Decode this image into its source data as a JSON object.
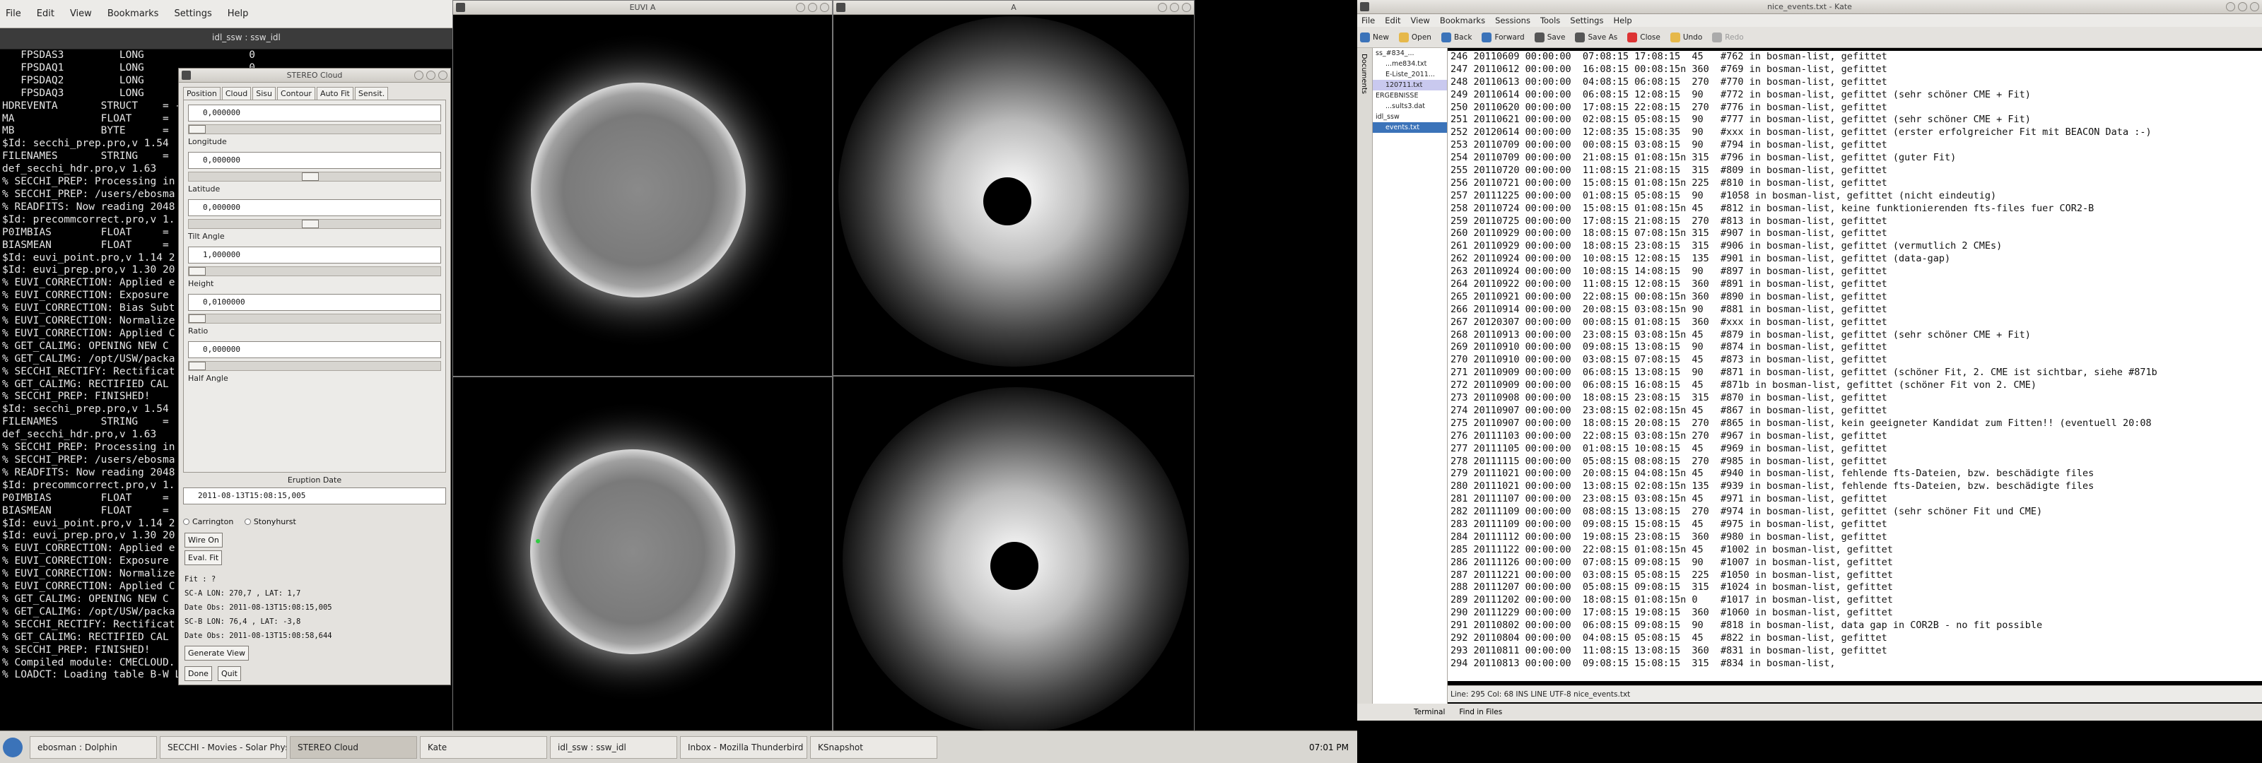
{
  "left_menu": [
    "File",
    "Edit",
    "View",
    "Bookmarks",
    "Settings",
    "Help"
  ],
  "terminal": {
    "title": "idl_ssw : ssw_idl",
    "lines": [
      "   FPSDAS3         LONG                 0",
      "   FPSDAQ1         LONG                 0",
      "   FPSDAQ2         LONG                 0",
      "   FPSDAQ3         LONG                 0",
      "HDREVENTA       STRUCT    = ->",
      "MA              FLOAT     =",
      "MB              BYTE      =",
      "",
      "$Id: secchi_prep.pro,v 1.54",
      "FILENAMES       STRING    =",
      "def_secchi_hdr.pro,v 1.63",
      "% SECCHI_PREP: Processing in",
      "% SECCHI_PREP: /users/ebosma",
      "% READFITS: Now reading 2048",
      "$Id: precommcorrect.pro,v 1.",
      "P0IMBIAS        FLOAT     =",
      "BIASMEAN        FLOAT     =",
      "$Id: euvi_point.pro,v 1.14 2",
      "$Id: euvi_prep.pro,v 1.30 20",
      "% EUVI_CORRECTION: Applied e",
      "% EUVI_CORRECTION: Exposure",
      "% EUVI_CORRECTION: Bias Subt",
      "% EUVI_CORRECTION: Normalize",
      "% EUVI_CORRECTION: Applied C",
      "% GET_CALIMG: OPENING NEW C",
      "% GET_CALIMG: /opt/USW/packa",
      "% SECCHI_RECTIFY: Rectificat",
      "% GET_CALIMG: RECTIFIED CAL",
      "% SECCHI_PREP: FINISHED!",
      "",
      "$Id: secchi_prep.pro,v 1.54",
      "FILENAMES       STRING    =",
      "def_secchi_hdr.pro,v 1.63",
      "% SECCHI_PREP: Processing in",
      "% SECCHI_PREP: /users/ebosma",
      "% READFITS: Now reading 2048",
      "$Id: precommcorrect.pro,v 1.",
      "P0IMBIAS        FLOAT     =",
      "BIASMEAN        FLOAT     =",
      "$Id: euvi_point.pro,v 1.14 2",
      "$Id: euvi_prep.pro,v 1.30 20",
      "% EUVI_CORRECTION: Applied e",
      "% EUVI_CORRECTION: Exposure",
      "% EUVI_CORRECTION: Normalize",
      "% EUVI_CORRECTION: Applied C",
      "% GET_CALIMG: OPENING NEW C",
      "% GET_CALIMG: /opt/USW/packa",
      "% SECCHI_RECTIFY: Rectificat",
      "% GET_CALIMG: RECTIFIED CAL",
      "% SECCHI_PREP: FINISHED!",
      "% Compiled module: CMECLOUD.",
      "% LOADCT: Loading table B-W LINEAR"
    ]
  },
  "cloud": {
    "title": "STEREO Cloud",
    "tabs": [
      "Position",
      "Cloud",
      "Sisu",
      "Contour",
      "Auto Fit",
      "Sensit."
    ],
    "fields": [
      {
        "label": "Longitude",
        "value": "0,000000"
      },
      {
        "label": "Latitude",
        "value": "0,000000"
      },
      {
        "label": "Tilt Angle",
        "value": "0,000000"
      },
      {
        "label": "Height",
        "value": "1,000000"
      },
      {
        "label": "Ratio",
        "value": "0,0100000"
      },
      {
        "label": "Half Angle",
        "value": "0,000000"
      }
    ],
    "eruption_label": "Eruption Date",
    "eruption_value": "2011-08-13T15:08:15,005",
    "radio_carrington": "Carrington",
    "radio_stonyhurst": "Stonyhurst",
    "wire_on": "Wire On",
    "eval_fit": "Eval. Fit",
    "fit_label": "Fit : ?",
    "sc_a": "SC-A LON:  270,7 , LAT:   1,7",
    "date_obs_a": "Date Obs: 2011-08-13T15:08:15,005",
    "sc_b": "SC-B LON:   76,4 , LAT:  -3,8",
    "date_obs_b": "Date Obs: 2011-08-13T15:08:58,644",
    "generate_view": "Generate View",
    "done": "Done",
    "quit": "Quit"
  },
  "image_windows": {
    "euvi_title": "EUVI A",
    "cor_title": "A"
  },
  "taskbar": [
    "ebosman : Dolphin",
    "SECCHI - Movies - Solar Physics",
    "STEREO Cloud",
    "Kate",
    "idl_ssw : ssw_idl",
    "Inbox - Mozilla Thunderbird",
    "KSnapshot"
  ],
  "clock": "07:01 PM",
  "kate": {
    "title": "nice_events.txt - Kate",
    "menu": [
      "File",
      "Edit",
      "View",
      "Bookmarks",
      "Sessions",
      "Tools",
      "Settings",
      "Help"
    ],
    "toolbar": [
      "New",
      "Open",
      "Back",
      "Forward",
      "Save",
      "Save As",
      "Close",
      "Undo",
      "Redo"
    ],
    "tree": [
      "ss_#834_...",
      "...me834.txt",
      "E-Liste_2011...",
      "120711.txt",
      "ERGEBNISSE",
      "...sults3.dat",
      "idl_ssw",
      "events.txt"
    ],
    "side_label": "Documents",
    "lines": [
      "246 20110609 00:00:00  07:08:15 17:08:15  45   #762 in bosman-list, gefittet",
      "247 20110612 00:00:00  16:08:15 00:08:15n 360  #769 in bosman-list, gefittet",
      "248 20110613 00:00:00  04:08:15 06:08:15  270  #770 in bosman-list, gefittet",
      "249 20110614 00:00:00  06:08:15 12:08:15  90   #772 in bosman-list, gefittet (sehr schöner CME + Fit)",
      "250 20110620 00:00:00  17:08:15 22:08:15  270  #776 in bosman-list, gefittet",
      "251 20110621 00:00:00  02:08:15 05:08:15  90   #777 in bosman-list, gefittet (sehr schöner CME + Fit)",
      "252 20120614 00:00:00  12:08:35 15:08:35  90   #xxx in bosman-list, gefittet (erster erfolgreicher Fit mit BEACON Data :-)",
      "253 20110709 00:00:00  00:08:15 03:08:15  90   #794 in bosman-list, gefittet",
      "254 20110709 00:00:00  21:08:15 01:08:15n 315  #796 in bosman-list, gefittet (guter Fit)",
      "255 20110720 00:00:00  11:08:15 21:08:15  315  #809 in bosman-list, gefittet",
      "256 20110721 00:00:00  15:08:15 01:08:15n 225  #810 in bosman-list, gefittet",
      "257 20111225 00:00:00  01:08:15 05:08:15  90   #1058 in bosman-list, gefittet (nicht eindeutig)",
      "258 20110724 00:00:00  15:08:15 01:08:15n 45   #812 in bosman-list, keine funktionierenden fts-files fuer COR2-B",
      "259 20110725 00:00:00  17:08:15 21:08:15  270  #813 in bosman-list, gefittet",
      "260 20110929 00:00:00  18:08:15 07:08:15n 315  #907 in bosman-list, gefittet",
      "261 20110929 00:00:00  18:08:15 23:08:15  315  #906 in bosman-list, gefittet (vermutlich 2 CMEs)",
      "262 20110924 00:00:00  10:08:15 12:08:15  135  #901 in bosman-list, gefittet (data-gap)",
      "263 20110924 00:00:00  10:08:15 14:08:15  90   #897 in bosman-list, gefittet",
      "264 20110922 00:00:00  11:08:15 12:08:15  360  #891 in bosman-list, gefittet",
      "265 20110921 00:00:00  22:08:15 00:08:15n 360  #890 in bosman-list, gefittet",
      "266 20110914 00:00:00  20:08:15 03:08:15n 90   #881 in bosman-list, gefittet",
      "267 20120307 00:00:00  00:08:15 01:08:15  360  #xxx in bosman-list, gefittet",
      "268 20110913 00:00:00  23:08:15 03:08:15n 45   #879 in bosman-list, gefittet (sehr schöner CME + Fit)",
      "269 20110910 00:00:00  09:08:15 13:08:15  90   #874 in bosman-list, gefittet",
      "270 20110910 00:00:00  03:08:15 07:08:15  45   #873 in bosman-list, gefittet",
      "271 20110909 00:00:00  06:08:15 13:08:15  90   #871 in bosman-list, gefittet (schöner Fit, 2. CME ist sichtbar, siehe #871b",
      "272 20110909 00:00:00  06:08:15 16:08:15  45   #871b in bosman-list, gefittet (schöner Fit von 2. CME)",
      "273 20110908 00:00:00  18:08:15 23:08:15  315  #870 in bosman-list, gefittet",
      "274 20110907 00:00:00  23:08:15 02:08:15n 45   #867 in bosman-list, gefittet",
      "275 20110907 00:00:00  18:08:15 20:08:15  270  #865 in bosman-list, kein geeigneter Kandidat zum Fitten!! (eventuell 20:08",
      "276 20111103 00:00:00  22:08:15 03:08:15n 270  #967 in bosman-list, gefittet",
      "277 20111105 00:00:00  01:08:15 10:08:15  45   #969 in bosman-list, gefittet",
      "278 20111115 00:00:00  05:08:15 08:08:15  270  #985 in bosman-list, gefittet",
      "279 20111021 00:00:00  20:08:15 04:08:15n 45   #940 in bosman-list, fehlende fts-Dateien, bzw. beschädigte files",
      "280 20111021 00:00:00  13:08:15 02:08:15n 135  #939 in bosman-list, fehlende fts-Dateien, bzw. beschädigte files",
      "281 20111107 00:00:00  23:08:15 03:08:15n 45   #971 in bosman-list, gefittet",
      "282 20111109 00:00:00  08:08:15 13:08:15  270  #974 in bosman-list, gefittet (sehr schöner Fit und CME)",
      "283 20111109 00:00:00  09:08:15 15:08:15  45   #975 in bosman-list, gefittet",
      "284 20111112 00:00:00  19:08:15 23:08:15  360  #980 in bosman-list, gefittet",
      "285 20111122 00:00:00  22:08:15 01:08:15n 45   #1002 in bosman-list, gefittet",
      "286 20111126 00:00:00  07:08:15 09:08:15  90   #1007 in bosman-list, gefittet",
      "287 20111221 00:00:00  03:08:15 05:08:15  225  #1050 in bosman-list, gefittet",
      "288 20111207 00:00:00  05:08:15 09:08:15  315  #1024 in bosman-list, gefittet",
      "289 20111202 00:00:00  18:08:15 01:08:15n 0    #1017 in bosman-list, gefittet",
      "290 20111229 00:00:00  17:08:15 19:08:15  360  #1060 in bosman-list, gefittet",
      "291 20110802 00:00:00  06:08:15 09:08:15  90   #818 in bosman-list, data gap in COR2B - no fit possible",
      "292 20110804 00:00:00  04:08:15 05:08:15  45   #822 in bosman-list, gefittet",
      "293 20110811 00:00:00  11:08:15 13:08:15  360  #831 in bosman-list, gefittet",
      "294 20110813 00:00:00  09:08:15 15:08:15  315  #834 in bosman-list,"
    ],
    "status": "Line: 295 Col: 68       INS  LINE  UTF-8  nice_events.txt",
    "bottom_terminal": "Terminal",
    "bottom_find": "Find in Files"
  }
}
